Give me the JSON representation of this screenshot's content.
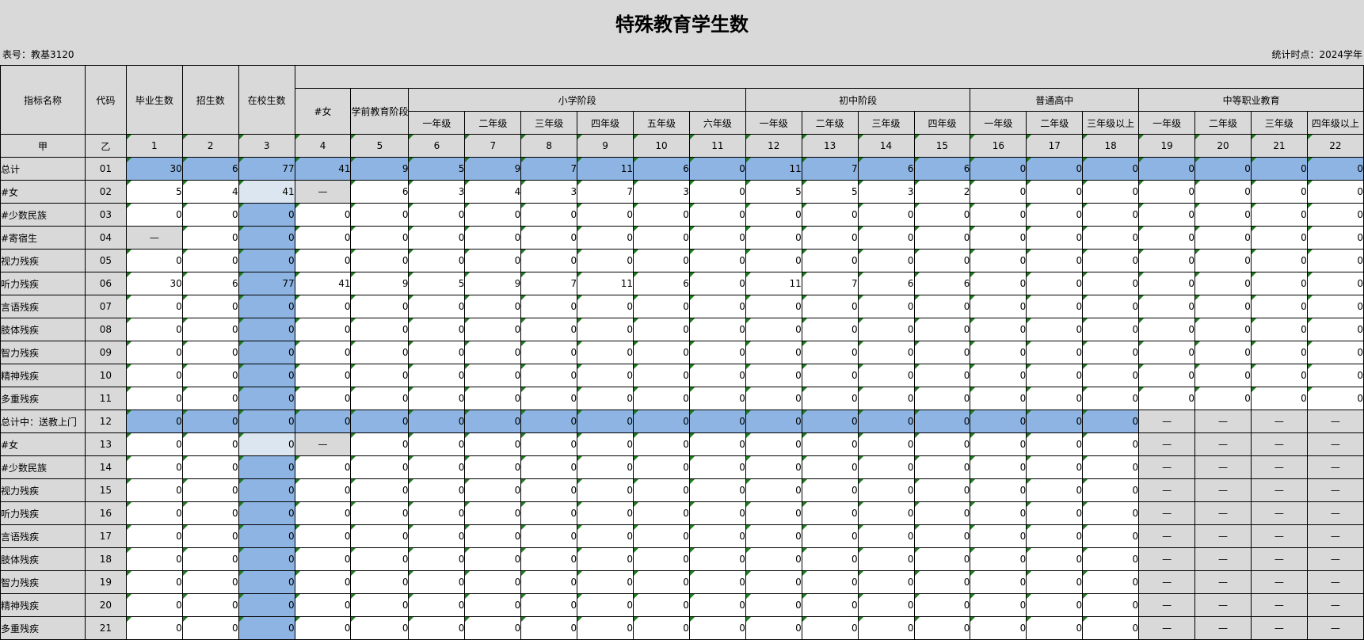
{
  "title": "特殊教育学生数",
  "table_no": "表号：教基3120",
  "stat_time": "统计时点：2024学年",
  "header": {
    "name": "指标名称",
    "code": "代码",
    "graduates": "毕业生数",
    "enrollment": "招生数",
    "in_school": "在校生数",
    "female": "#女",
    "preschool": "学前教育阶段",
    "primary": "小学阶段",
    "junior": "初中阶段",
    "senior": "普通高中",
    "vocational": "中等职业教育",
    "grades": [
      "一年级",
      "二年级",
      "三年级",
      "四年级",
      "五年级",
      "六年级",
      "一年级",
      "二年级",
      "三年级",
      "四年级",
      "一年级",
      "二年级",
      "三年级以上",
      "一年级",
      "二年级",
      "三年级",
      "四年级以上"
    ]
  },
  "index_row": [
    "甲",
    "乙",
    "1",
    "2",
    "3",
    "4",
    "5",
    "6",
    "7",
    "8",
    "9",
    "10",
    "11",
    "12",
    "13",
    "14",
    "15",
    "16",
    "17",
    "18",
    "19",
    "20",
    "21",
    "22"
  ],
  "rows": [
    {
      "name": "总计",
      "code": "01",
      "values": [
        "30",
        "6",
        "77",
        "41",
        "9",
        "5",
        "9",
        "7",
        "11",
        "6",
        "0",
        "11",
        "7",
        "6",
        "6",
        "0",
        "0",
        "0",
        "0",
        "0",
        "0",
        "0"
      ]
    },
    {
      "name": "#女",
      "code": "02",
      "values": [
        "5",
        "4",
        "41",
        "—",
        "6",
        "3",
        "4",
        "3",
        "7",
        "3",
        "0",
        "5",
        "5",
        "3",
        "2",
        "0",
        "0",
        "0",
        "0",
        "0",
        "0",
        "0"
      ]
    },
    {
      "name": "#少数民族",
      "code": "03",
      "values": [
        "0",
        "0",
        "0",
        "0",
        "0",
        "0",
        "0",
        "0",
        "0",
        "0",
        "0",
        "0",
        "0",
        "0",
        "0",
        "0",
        "0",
        "0",
        "0",
        "0",
        "0",
        "0"
      ]
    },
    {
      "name": "#寄宿生",
      "code": "04",
      "values": [
        "—",
        "0",
        "0",
        "0",
        "0",
        "0",
        "0",
        "0",
        "0",
        "0",
        "0",
        "0",
        "0",
        "0",
        "0",
        "0",
        "0",
        "0",
        "0",
        "0",
        "0",
        "0"
      ]
    },
    {
      "name": "视力残疾",
      "code": "05",
      "values": [
        "0",
        "0",
        "0",
        "0",
        "0",
        "0",
        "0",
        "0",
        "0",
        "0",
        "0",
        "0",
        "0",
        "0",
        "0",
        "0",
        "0",
        "0",
        "0",
        "0",
        "0",
        "0"
      ]
    },
    {
      "name": "听力残疾",
      "code": "06",
      "values": [
        "30",
        "6",
        "77",
        "41",
        "9",
        "5",
        "9",
        "7",
        "11",
        "6",
        "0",
        "11",
        "7",
        "6",
        "6",
        "0",
        "0",
        "0",
        "0",
        "0",
        "0",
        "0"
      ]
    },
    {
      "name": "言语残疾",
      "code": "07",
      "values": [
        "0",
        "0",
        "0",
        "0",
        "0",
        "0",
        "0",
        "0",
        "0",
        "0",
        "0",
        "0",
        "0",
        "0",
        "0",
        "0",
        "0",
        "0",
        "0",
        "0",
        "0",
        "0"
      ]
    },
    {
      "name": "肢体残疾",
      "code": "08",
      "values": [
        "0",
        "0",
        "0",
        "0",
        "0",
        "0",
        "0",
        "0",
        "0",
        "0",
        "0",
        "0",
        "0",
        "0",
        "0",
        "0",
        "0",
        "0",
        "0",
        "0",
        "0",
        "0"
      ]
    },
    {
      "name": "智力残疾",
      "code": "09",
      "values": [
        "0",
        "0",
        "0",
        "0",
        "0",
        "0",
        "0",
        "0",
        "0",
        "0",
        "0",
        "0",
        "0",
        "0",
        "0",
        "0",
        "0",
        "0",
        "0",
        "0",
        "0",
        "0"
      ]
    },
    {
      "name": "精神残疾",
      "code": "10",
      "values": [
        "0",
        "0",
        "0",
        "0",
        "0",
        "0",
        "0",
        "0",
        "0",
        "0",
        "0",
        "0",
        "0",
        "0",
        "0",
        "0",
        "0",
        "0",
        "0",
        "0",
        "0",
        "0"
      ]
    },
    {
      "name": "多重残疾",
      "code": "11",
      "values": [
        "0",
        "0",
        "0",
        "0",
        "0",
        "0",
        "0",
        "0",
        "0",
        "0",
        "0",
        "0",
        "0",
        "0",
        "0",
        "0",
        "0",
        "0",
        "0",
        "0",
        "0",
        "0"
      ]
    },
    {
      "name": "总计中：送教上门",
      "code": "12",
      "values": [
        "0",
        "0",
        "0",
        "0",
        "0",
        "0",
        "0",
        "0",
        "0",
        "0",
        "0",
        "0",
        "0",
        "0",
        "0",
        "0",
        "0",
        "0",
        "—",
        "—",
        "—",
        "—"
      ]
    },
    {
      "name": "#女",
      "code": "13",
      "values": [
        "0",
        "0",
        "0",
        "—",
        "0",
        "0",
        "0",
        "0",
        "0",
        "0",
        "0",
        "0",
        "0",
        "0",
        "0",
        "0",
        "0",
        "0",
        "—",
        "—",
        "—",
        "—"
      ]
    },
    {
      "name": "#少数民族",
      "code": "14",
      "values": [
        "0",
        "0",
        "0",
        "0",
        "0",
        "0",
        "0",
        "0",
        "0",
        "0",
        "0",
        "0",
        "0",
        "0",
        "0",
        "0",
        "0",
        "0",
        "—",
        "—",
        "—",
        "—"
      ]
    },
    {
      "name": "视力残疾",
      "code": "15",
      "values": [
        "0",
        "0",
        "0",
        "0",
        "0",
        "0",
        "0",
        "0",
        "0",
        "0",
        "0",
        "0",
        "0",
        "0",
        "0",
        "0",
        "0",
        "0",
        "—",
        "—",
        "—",
        "—"
      ]
    },
    {
      "name": "听力残疾",
      "code": "16",
      "values": [
        "0",
        "0",
        "0",
        "0",
        "0",
        "0",
        "0",
        "0",
        "0",
        "0",
        "0",
        "0",
        "0",
        "0",
        "0",
        "0",
        "0",
        "0",
        "—",
        "—",
        "—",
        "—"
      ]
    },
    {
      "name": "言语残疾",
      "code": "17",
      "values": [
        "0",
        "0",
        "0",
        "0",
        "0",
        "0",
        "0",
        "0",
        "0",
        "0",
        "0",
        "0",
        "0",
        "0",
        "0",
        "0",
        "0",
        "0",
        "—",
        "—",
        "—",
        "—"
      ]
    },
    {
      "name": "肢体残疾",
      "code": "18",
      "values": [
        "0",
        "0",
        "0",
        "0",
        "0",
        "0",
        "0",
        "0",
        "0",
        "0",
        "0",
        "0",
        "0",
        "0",
        "0",
        "0",
        "0",
        "0",
        "—",
        "—",
        "—",
        "—"
      ]
    },
    {
      "name": "智力残疾",
      "code": "19",
      "values": [
        "0",
        "0",
        "0",
        "0",
        "0",
        "0",
        "0",
        "0",
        "0",
        "0",
        "0",
        "0",
        "0",
        "0",
        "0",
        "0",
        "0",
        "0",
        "—",
        "—",
        "—",
        "—"
      ]
    },
    {
      "name": "精神残疾",
      "code": "20",
      "values": [
        "0",
        "0",
        "0",
        "0",
        "0",
        "0",
        "0",
        "0",
        "0",
        "0",
        "0",
        "0",
        "0",
        "0",
        "0",
        "0",
        "0",
        "0",
        "—",
        "—",
        "—",
        "—"
      ]
    },
    {
      "name": "多重残疾",
      "code": "21",
      "values": [
        "0",
        "0",
        "0",
        "0",
        "0",
        "0",
        "0",
        "0",
        "0",
        "0",
        "0",
        "0",
        "0",
        "0",
        "0",
        "0",
        "0",
        "0",
        "—",
        "—",
        "—",
        "—"
      ]
    }
  ],
  "colors": {
    "total_row": "#8db4e2",
    "in_school_column": "#8db4e2",
    "female_in_school": "#dce6f1",
    "readonly": "#d9d9d9",
    "editable": "#ffffff",
    "cell_marker": "#1e7a1e"
  }
}
